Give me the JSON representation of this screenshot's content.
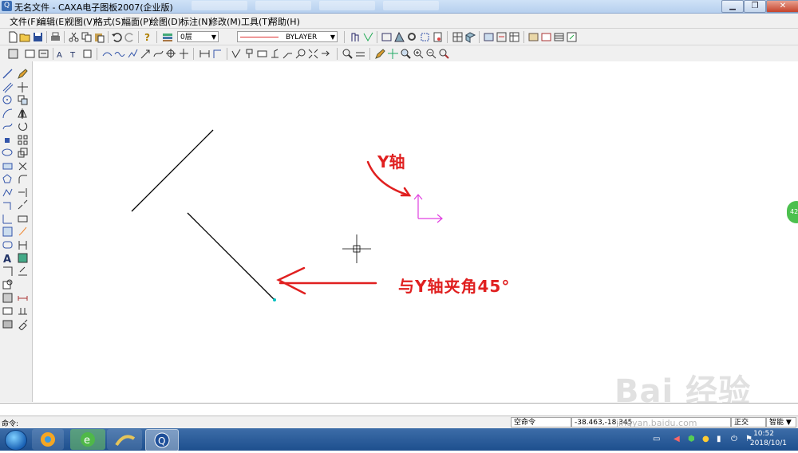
{
  "window": {
    "title": "无名文件 - CAXA电子图板2007(企业版)",
    "icon_glyph": "Q"
  },
  "menu": [
    "文件(F)",
    "编辑(E)",
    "视图(V)",
    "格式(S)",
    "幅面(P)",
    "绘图(D)",
    "标注(N)",
    "修改(M)",
    "工具(T)",
    "帮助(H)"
  ],
  "toolbar": {
    "layer_value": "0层",
    "linetype_value": "BYLAYER"
  },
  "annotations": {
    "y_axis": "Y轴",
    "angle_note": "与Y轴夹角45°"
  },
  "status": {
    "command_label": "命令:",
    "prompt": "空命令",
    "coordinates": "-38.463,-18.345",
    "ortho": "正交",
    "mode": "智能"
  },
  "taskbar": {
    "time": "10:52",
    "date": "2018/10/1"
  },
  "watermark": {
    "logo": "Bai 经验",
    "url": "jingyan.baidu.com"
  },
  "badge": {
    "text": "42"
  },
  "colors": {
    "annotation": "#e02020",
    "ucs_axis": "#e040e0",
    "endpoint": "#00c0c0"
  }
}
